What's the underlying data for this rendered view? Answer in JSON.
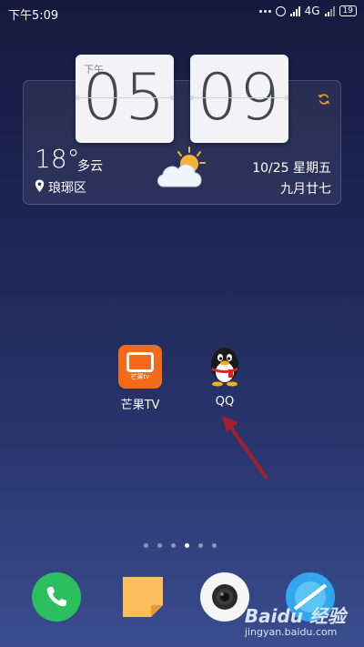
{
  "status_bar": {
    "time": "下午5:09",
    "network": "4G",
    "battery": "19"
  },
  "clock_widget": {
    "ampm": "下午",
    "hour": "05",
    "minute": "09"
  },
  "weather": {
    "temperature": "18°",
    "condition": "多云",
    "location": "琅琊区",
    "date": "10/25  星期五",
    "lunar_date": "九月廿七"
  },
  "apps": [
    {
      "label": "芒果TV",
      "icon": "mango-tv-icon",
      "brand_text": "芒果tv"
    },
    {
      "label": "QQ",
      "icon": "qq-penguin-icon"
    }
  ],
  "page_indicator": {
    "count": 6,
    "active_index": 3
  },
  "dock": [
    {
      "icon": "phone-icon"
    },
    {
      "icon": "messages-icon"
    },
    {
      "icon": "camera-icon"
    },
    {
      "icon": "browser-icon"
    }
  ],
  "watermark": {
    "main": "Baidu 经验",
    "sub": "jingyan.baidu.com"
  },
  "colors": {
    "mango_orange": "#f36a1b",
    "phone_green": "#2bbf5d",
    "arrow_red": "#a0202e",
    "sync_orange": "#f0a020"
  }
}
